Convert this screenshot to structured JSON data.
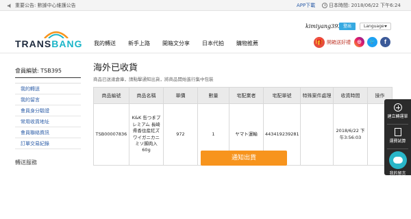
{
  "topbar": {
    "notice": "重要公告: 數據中心維護公告",
    "app_download": "APP下載",
    "time": "日本時間: 2018/06/22 下午6:24"
  },
  "header": {
    "logo_part1": "TRANS",
    "logo_part2": "BANG",
    "username": "kimiyang393",
    "logout_label": "登出",
    "language_label": "Language",
    "share_label": "開箱送好禮",
    "nav": [
      "我的轉送",
      "新手上路",
      "開箱文分享",
      "日本代拍",
      "購物推薦"
    ]
  },
  "sidebar": {
    "member_label": "會員編號: TSB395",
    "items": [
      "我的轉送",
      "我的留言",
      "會員身分驗證",
      "常用收貨地址",
      "會員聯絡資訊",
      "訂單交易紀錄"
    ],
    "section_title": "轉送服務"
  },
  "main": {
    "title": "海外已收貨",
    "subtitle": "商品已送達倉庫，請點擊通知出貨，將商品開始進行集中包裝",
    "table_headers": [
      "商品編號",
      "商品名稱",
      "單價",
      "數量",
      "宅配業者",
      "宅配單號",
      "特殊案件處理",
      "收貨時間",
      "操作"
    ],
    "rows": [
      {
        "id": "TSB00007836",
        "name": "K&K 缶つまプレミアム 長崎県香住産紅ズワイガニカニミソ脚肉入 60g",
        "price": "972",
        "qty": "1",
        "carrier": "ヤマト運輸",
        "tracking": "443419239281",
        "special": "",
        "received": "2018/6/22 下午3:56:03",
        "action": ""
      }
    ],
    "notify_button": "通知出貨"
  },
  "floating": {
    "create_order": "建立轉運單",
    "calc": "運費試算",
    "chat": "我的留言"
  },
  "colors": {
    "accent_orange": "#f7941d",
    "link_blue": "#2d5ea8",
    "brand_teal": "#1bb5c8"
  }
}
